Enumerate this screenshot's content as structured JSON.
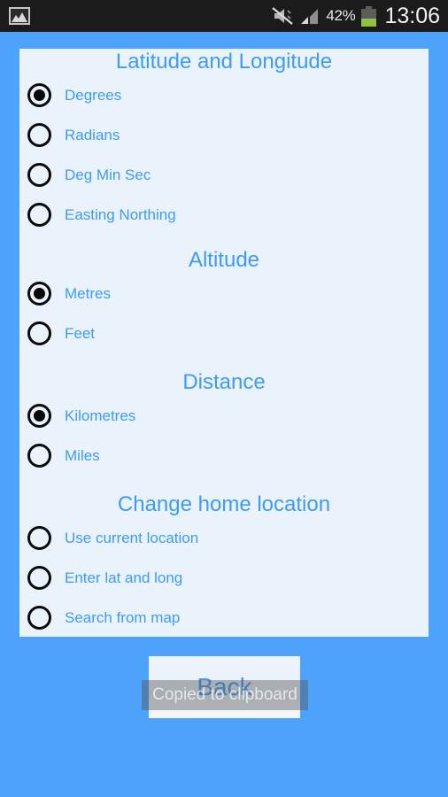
{
  "statusbar": {
    "notification_icon": "gallery-icon",
    "mute_icon": "mute-vibrate-off-icon",
    "signal_icon": "signal-bars-icon",
    "battery_percent": "42%",
    "battery_level": 42,
    "battery_icon": "battery-icon",
    "clock": "13:06",
    "background": "#1b1b1b"
  },
  "theme": {
    "page_background": "#4da2fc",
    "panel_background": "#eaf3fc",
    "accent_blue": "#3d9bf7",
    "radio_color": "#0a0a0a"
  },
  "panel": {
    "sections": [
      {
        "title": "Latitude and Longitude",
        "options": [
          {
            "label": "Degrees",
            "selected": true
          },
          {
            "label": "Radians",
            "selected": false
          },
          {
            "label": "Deg Min Sec",
            "selected": false
          },
          {
            "label": "Easting Northing",
            "selected": false
          }
        ]
      },
      {
        "title": "Altitude",
        "options": [
          {
            "label": "Metres",
            "selected": true
          },
          {
            "label": "Feet",
            "selected": false
          }
        ]
      },
      {
        "title": "Distance",
        "options": [
          {
            "label": "Kilometres",
            "selected": true
          },
          {
            "label": "Miles",
            "selected": false
          }
        ]
      },
      {
        "title": "Change home location",
        "options": [
          {
            "label": "Use current location",
            "selected": false
          },
          {
            "label": "Enter lat and long",
            "selected": false
          },
          {
            "label": "Search from map",
            "selected": false
          }
        ]
      }
    ]
  },
  "footer": {
    "back_label": "Back"
  },
  "toast": {
    "message": "Copied to clipboard"
  }
}
